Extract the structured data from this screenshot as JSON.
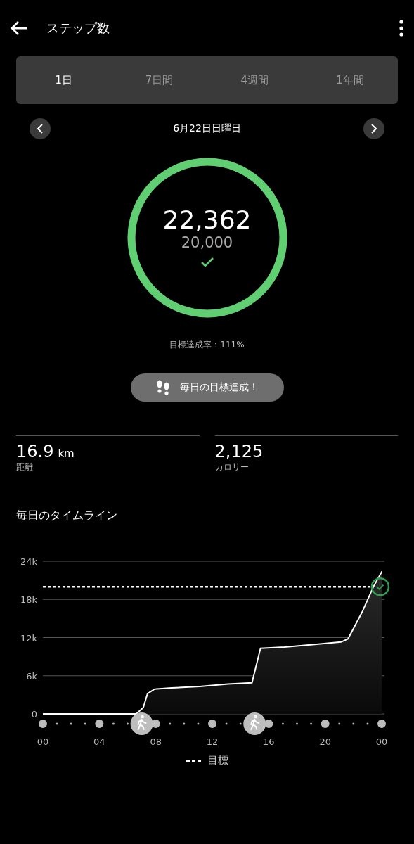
{
  "header": {
    "title": "ステップ数"
  },
  "tabs": [
    {
      "label": "1日",
      "selected": true
    },
    {
      "label": "7日間",
      "selected": false
    },
    {
      "label": "4週間",
      "selected": false
    },
    {
      "label": "1年間",
      "selected": false
    }
  ],
  "date": "6月22日日曜日",
  "ring": {
    "steps": "22,362",
    "goal": "20,000",
    "level": 1,
    "achieved": true
  },
  "rate": "目標達成率：111%",
  "badge": "毎日の目標達成！",
  "stats": [
    {
      "value": "16.9",
      "unit": "km",
      "label": "距離"
    },
    {
      "value": "2,125",
      "label": "カロリー"
    }
  ],
  "timeline": {
    "title": "毎日のタイムライン",
    "chart_data": {
      "type": "area",
      "grid": true,
      "x": [
        0,
        6.5,
        7,
        7.3,
        7.8,
        9,
        11,
        13,
        14.7,
        15.3,
        17,
        19,
        21,
        21.5,
        22.5,
        23.3,
        23.9
      ],
      "series": [
        {
          "color": "#ffffff",
          "values": [
            0,
            0,
            1000,
            3200,
            3900,
            4100,
            4300,
            4700,
            4900,
            10300,
            10500,
            10900,
            11300,
            11800,
            16000,
            20000,
            22400
          ]
        }
      ],
      "ref_lines": [
        {
          "axis": "y",
          "value": 20000,
          "label": "目標",
          "color": "#ffffff",
          "line_style": "dashed"
        }
      ],
      "xlim": [
        0,
        24
      ],
      "ylim": [
        0,
        24000
      ],
      "xticks": [
        {
          "value": 0,
          "label": "00"
        },
        {
          "value": 4,
          "label": "04"
        },
        {
          "value": 8,
          "label": "08"
        },
        {
          "value": 12,
          "label": "12"
        },
        {
          "value": 16,
          "label": "16"
        },
        {
          "value": 20,
          "label": "20"
        },
        {
          "value": 24,
          "label": "00"
        }
      ],
      "yticks": [
        {
          "value": 0,
          "label": "0"
        },
        {
          "value": 6000,
          "label": "6k"
        },
        {
          "value": 12000,
          "label": "12k"
        },
        {
          "value": 18000,
          "label": "18k"
        },
        {
          "value": 24000,
          "label": "24k"
        }
      ]
    }
  }
}
